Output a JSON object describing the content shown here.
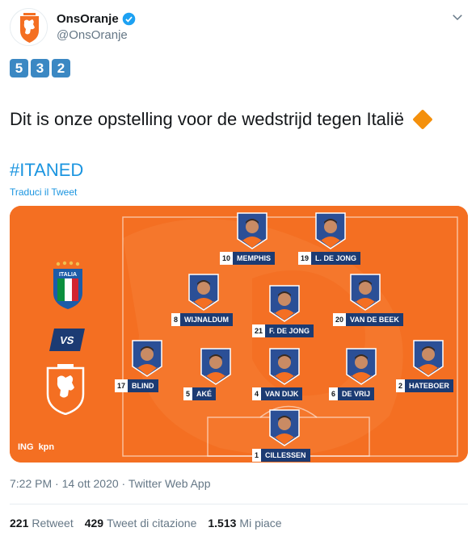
{
  "header": {
    "display_name": "OnsOranje",
    "handle": "@OnsOranje"
  },
  "badges": [
    "5",
    "3",
    "2"
  ],
  "tweet": {
    "text": "Dit is onze opstelling voor de wedstrijd tegen Italië",
    "hashtag": "#ITANED",
    "translate_label": "Traduci il Tweet",
    "timestamp": "7:22 PM · 14 ott 2020 · Twitter Web App"
  },
  "card": {
    "vs_label": "VS",
    "italia_label": "ITALIA",
    "sponsors": [
      "ING",
      "kpn"
    ],
    "players": [
      {
        "number": "10",
        "name": "MEMPHIS"
      },
      {
        "number": "19",
        "name": "L. DE JONG"
      },
      {
        "number": "8",
        "name": "WIJNALDUM"
      },
      {
        "number": "21",
        "name": "F. DE JONG"
      },
      {
        "number": "20",
        "name": "VAN DE BEEK"
      },
      {
        "number": "17",
        "name": "BLIND"
      },
      {
        "number": "5",
        "name": "AKÉ"
      },
      {
        "number": "4",
        "name": "VAN DIJK"
      },
      {
        "number": "6",
        "name": "DE VRIJ"
      },
      {
        "number": "2",
        "name": "HATEBOER"
      },
      {
        "number": "1",
        "name": "CILLESSEN"
      }
    ]
  },
  "stats": {
    "retweets_count": "221",
    "retweets_label": "Retweet",
    "quotes_count": "429",
    "quotes_label": "Tweet di citazione",
    "likes_count": "1.513",
    "likes_label": "Mi piace"
  },
  "colors": {
    "accent": "#1b95e0",
    "orange": "#f46f22",
    "navy": "#1c3b73",
    "badge_blue": "#3b88c3"
  },
  "icons": [
    "knvb-lion-icon",
    "verified-icon",
    "caret-down-icon",
    "diamond-icon",
    "italia-crest-icon"
  ]
}
